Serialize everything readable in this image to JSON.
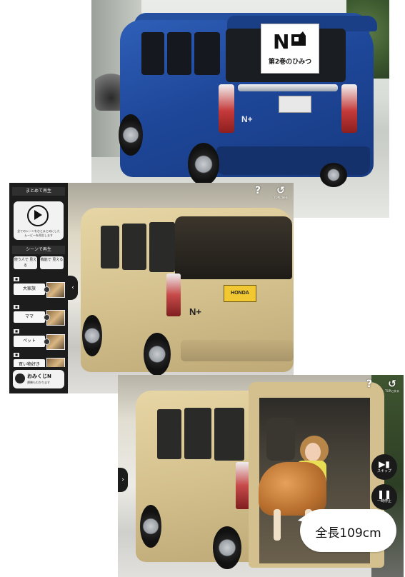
{
  "panel1": {
    "sign_line": "第2巻のひみつ",
    "badge": "N+"
  },
  "panel2": {
    "sidebar": {
      "section_all": "まとめて再生",
      "play_desc": "全てのシーンをひとまとめにしたムービーを再生します",
      "section_scene": "シーンで再生",
      "mini_buttons": [
        "使う人で 見える",
        "機能で 見える"
      ],
      "items": [
        {
          "tag": "■",
          "label": "大家族"
        },
        {
          "tag": "■",
          "label": "ママ"
        },
        {
          "tag": "■",
          "label": "ペット"
        },
        {
          "tag": "■",
          "label": "買い物好き"
        }
      ],
      "omikuji_title": "おみくじN",
      "omikuji_sub": "運勢もわかります",
      "collapse": "‹"
    },
    "help_icon": "?",
    "back_icon": "↺",
    "back_label": "TOPに戻る",
    "plate": "HONDA",
    "badge": "N+"
  },
  "panel3": {
    "help_icon": "?",
    "back_icon": "↺",
    "back_label": "TOPに戻る",
    "expand": "›",
    "skip_label": "スキップ",
    "pause_label": "一時停止",
    "bubble_text": "全長109cm"
  }
}
